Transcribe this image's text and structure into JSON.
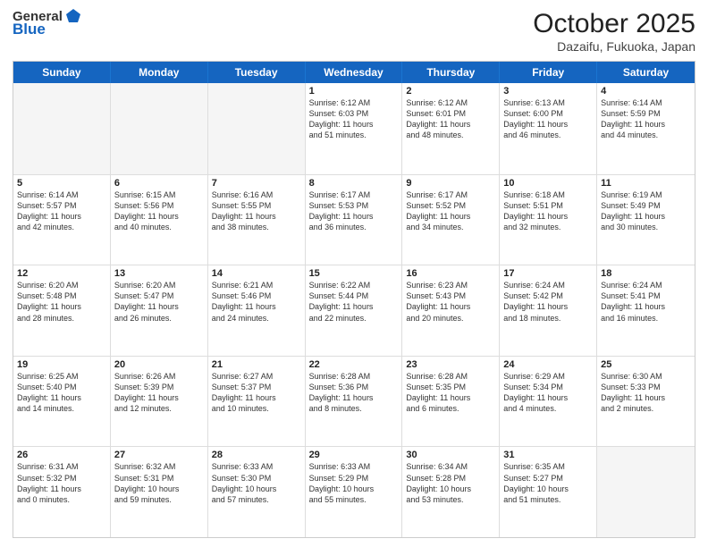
{
  "logo": {
    "general": "General",
    "blue": "Blue"
  },
  "header": {
    "month_year": "October 2025",
    "location": "Dazaifu, Fukuoka, Japan"
  },
  "weekdays": [
    "Sunday",
    "Monday",
    "Tuesday",
    "Wednesday",
    "Thursday",
    "Friday",
    "Saturday"
  ],
  "weeks": [
    [
      {
        "day": "",
        "info": "",
        "empty": true
      },
      {
        "day": "",
        "info": "",
        "empty": true
      },
      {
        "day": "",
        "info": "",
        "empty": true
      },
      {
        "day": "1",
        "info": "Sunrise: 6:12 AM\nSunset: 6:03 PM\nDaylight: 11 hours\nand 51 minutes.",
        "empty": false
      },
      {
        "day": "2",
        "info": "Sunrise: 6:12 AM\nSunset: 6:01 PM\nDaylight: 11 hours\nand 48 minutes.",
        "empty": false
      },
      {
        "day": "3",
        "info": "Sunrise: 6:13 AM\nSunset: 6:00 PM\nDaylight: 11 hours\nand 46 minutes.",
        "empty": false
      },
      {
        "day": "4",
        "info": "Sunrise: 6:14 AM\nSunset: 5:59 PM\nDaylight: 11 hours\nand 44 minutes.",
        "empty": false
      }
    ],
    [
      {
        "day": "5",
        "info": "Sunrise: 6:14 AM\nSunset: 5:57 PM\nDaylight: 11 hours\nand 42 minutes.",
        "empty": false
      },
      {
        "day": "6",
        "info": "Sunrise: 6:15 AM\nSunset: 5:56 PM\nDaylight: 11 hours\nand 40 minutes.",
        "empty": false
      },
      {
        "day": "7",
        "info": "Sunrise: 6:16 AM\nSunset: 5:55 PM\nDaylight: 11 hours\nand 38 minutes.",
        "empty": false
      },
      {
        "day": "8",
        "info": "Sunrise: 6:17 AM\nSunset: 5:53 PM\nDaylight: 11 hours\nand 36 minutes.",
        "empty": false
      },
      {
        "day": "9",
        "info": "Sunrise: 6:17 AM\nSunset: 5:52 PM\nDaylight: 11 hours\nand 34 minutes.",
        "empty": false
      },
      {
        "day": "10",
        "info": "Sunrise: 6:18 AM\nSunset: 5:51 PM\nDaylight: 11 hours\nand 32 minutes.",
        "empty": false
      },
      {
        "day": "11",
        "info": "Sunrise: 6:19 AM\nSunset: 5:49 PM\nDaylight: 11 hours\nand 30 minutes.",
        "empty": false
      }
    ],
    [
      {
        "day": "12",
        "info": "Sunrise: 6:20 AM\nSunset: 5:48 PM\nDaylight: 11 hours\nand 28 minutes.",
        "empty": false
      },
      {
        "day": "13",
        "info": "Sunrise: 6:20 AM\nSunset: 5:47 PM\nDaylight: 11 hours\nand 26 minutes.",
        "empty": false
      },
      {
        "day": "14",
        "info": "Sunrise: 6:21 AM\nSunset: 5:46 PM\nDaylight: 11 hours\nand 24 minutes.",
        "empty": false
      },
      {
        "day": "15",
        "info": "Sunrise: 6:22 AM\nSunset: 5:44 PM\nDaylight: 11 hours\nand 22 minutes.",
        "empty": false
      },
      {
        "day": "16",
        "info": "Sunrise: 6:23 AM\nSunset: 5:43 PM\nDaylight: 11 hours\nand 20 minutes.",
        "empty": false
      },
      {
        "day": "17",
        "info": "Sunrise: 6:24 AM\nSunset: 5:42 PM\nDaylight: 11 hours\nand 18 minutes.",
        "empty": false
      },
      {
        "day": "18",
        "info": "Sunrise: 6:24 AM\nSunset: 5:41 PM\nDaylight: 11 hours\nand 16 minutes.",
        "empty": false
      }
    ],
    [
      {
        "day": "19",
        "info": "Sunrise: 6:25 AM\nSunset: 5:40 PM\nDaylight: 11 hours\nand 14 minutes.",
        "empty": false
      },
      {
        "day": "20",
        "info": "Sunrise: 6:26 AM\nSunset: 5:39 PM\nDaylight: 11 hours\nand 12 minutes.",
        "empty": false
      },
      {
        "day": "21",
        "info": "Sunrise: 6:27 AM\nSunset: 5:37 PM\nDaylight: 11 hours\nand 10 minutes.",
        "empty": false
      },
      {
        "day": "22",
        "info": "Sunrise: 6:28 AM\nSunset: 5:36 PM\nDaylight: 11 hours\nand 8 minutes.",
        "empty": false
      },
      {
        "day": "23",
        "info": "Sunrise: 6:28 AM\nSunset: 5:35 PM\nDaylight: 11 hours\nand 6 minutes.",
        "empty": false
      },
      {
        "day": "24",
        "info": "Sunrise: 6:29 AM\nSunset: 5:34 PM\nDaylight: 11 hours\nand 4 minutes.",
        "empty": false
      },
      {
        "day": "25",
        "info": "Sunrise: 6:30 AM\nSunset: 5:33 PM\nDaylight: 11 hours\nand 2 minutes.",
        "empty": false
      }
    ],
    [
      {
        "day": "26",
        "info": "Sunrise: 6:31 AM\nSunset: 5:32 PM\nDaylight: 11 hours\nand 0 minutes.",
        "empty": false
      },
      {
        "day": "27",
        "info": "Sunrise: 6:32 AM\nSunset: 5:31 PM\nDaylight: 10 hours\nand 59 minutes.",
        "empty": false
      },
      {
        "day": "28",
        "info": "Sunrise: 6:33 AM\nSunset: 5:30 PM\nDaylight: 10 hours\nand 57 minutes.",
        "empty": false
      },
      {
        "day": "29",
        "info": "Sunrise: 6:33 AM\nSunset: 5:29 PM\nDaylight: 10 hours\nand 55 minutes.",
        "empty": false
      },
      {
        "day": "30",
        "info": "Sunrise: 6:34 AM\nSunset: 5:28 PM\nDaylight: 10 hours\nand 53 minutes.",
        "empty": false
      },
      {
        "day": "31",
        "info": "Sunrise: 6:35 AM\nSunset: 5:27 PM\nDaylight: 10 hours\nand 51 minutes.",
        "empty": false
      },
      {
        "day": "",
        "info": "",
        "empty": true
      }
    ]
  ]
}
